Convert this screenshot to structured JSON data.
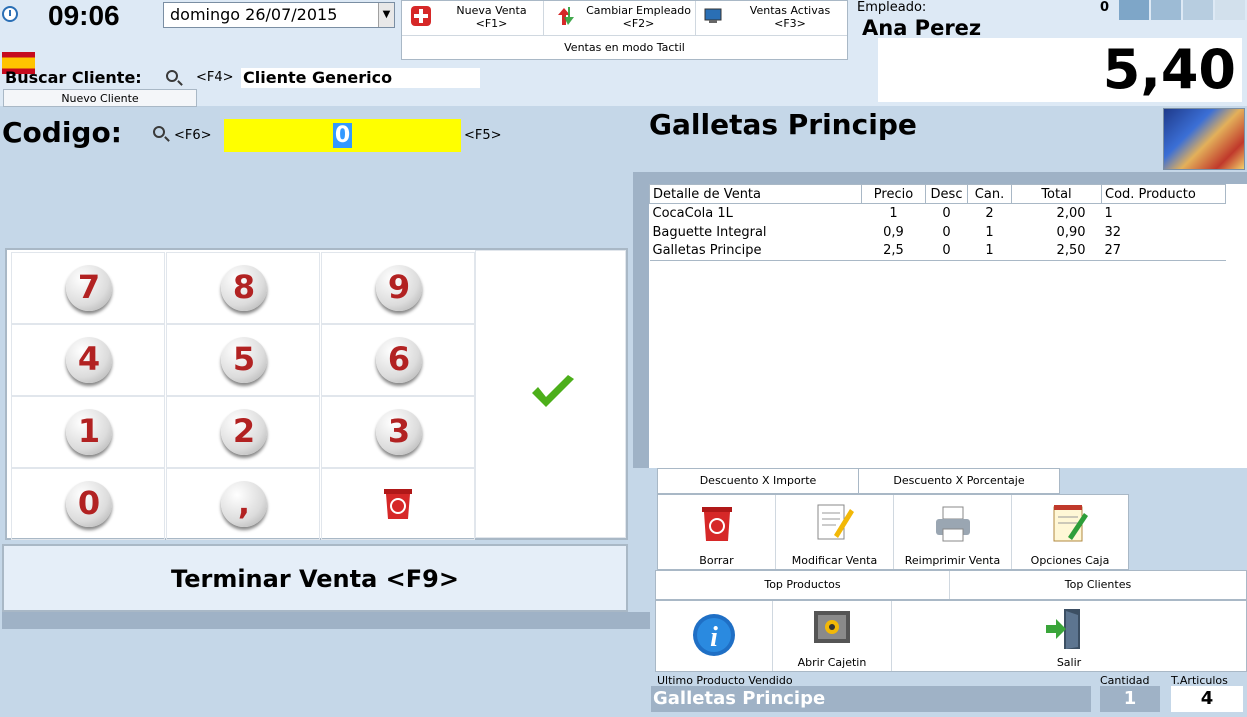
{
  "header": {
    "time": "09:06",
    "date": "domingo  26/07/2015",
    "toolbar": {
      "nueva_venta": "Nueva Venta",
      "nueva_venta_key": "<F1>",
      "cambiar_empleado": "Cambiar Empleado",
      "cambiar_empleado_key": "<F2>",
      "ventas_activas": "Ventas Activas",
      "ventas_activas_key": "<F3>",
      "modo_tactil": "Ventas en modo Tactil"
    },
    "empleado_label": "Empleado:",
    "empleado_name": "Ana Perez",
    "ventas_count": "0",
    "total": "5,40"
  },
  "cliente": {
    "buscar_label": "Buscar Cliente:",
    "shortcut": "<F4>",
    "value": "Cliente Generico",
    "nuevo_button": "Nuevo Cliente"
  },
  "codigo": {
    "label": "Codigo:",
    "search_key": "<F6>",
    "value": "0",
    "enter_key": "<F5>"
  },
  "product_title": "Galletas Principe",
  "keypad": {
    "keys": [
      "7",
      "8",
      "9",
      "4",
      "5",
      "6",
      "1",
      "2",
      "3",
      "0",
      ","
    ]
  },
  "terminar_label": "Terminar Venta <F9>",
  "sale_table": {
    "headers": [
      "Detalle de Venta",
      "Precio",
      "Desc",
      "Can.",
      "Total",
      "Cod. Producto"
    ],
    "rows": [
      [
        "CocaCola 1L",
        "1",
        "0",
        "2",
        "2,00",
        "1"
      ],
      [
        "Baguette Integral",
        "0,9",
        "0",
        "1",
        "0,90",
        "32"
      ],
      [
        "Galletas Principe",
        "2,5",
        "0",
        "1",
        "2,50",
        "27"
      ]
    ]
  },
  "tabs": {
    "descuento_importe": "Descuento X Importe",
    "descuento_porcentaje": "Descuento X Porcentaje"
  },
  "actions": {
    "borrar": "Borrar",
    "modificar": "Modificar Venta",
    "reimprimir": "Reimprimir Venta",
    "opciones": "Opciones Caja"
  },
  "top": {
    "productos": "Top Productos",
    "clientes": "Top Clientes"
  },
  "bottom_actions": {
    "abrir_cajetin": "Abrir Cajetin",
    "salir": "Salir"
  },
  "footer": {
    "ultimo_label": "Ultimo Producto Vendido",
    "ultimo_value": "Galletas Principe",
    "cantidad_label": "Cantidad",
    "cantidad_value": "1",
    "articulos_label": "T.Articulos",
    "articulos_value": "4"
  },
  "colors": {
    "code_input_bg": "#ffff00",
    "panel_bg": "#c5d7e8",
    "key_red": "#b22222",
    "check_green": "#4caf1a"
  }
}
